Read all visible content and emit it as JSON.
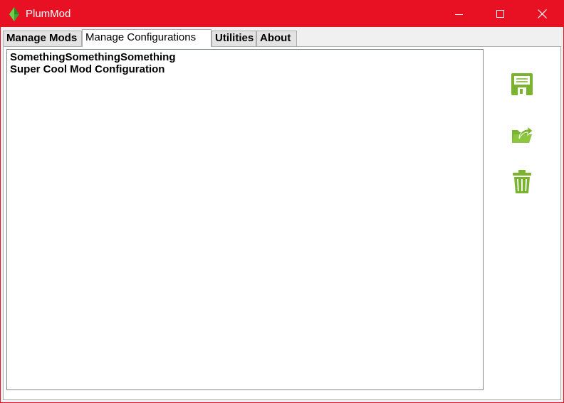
{
  "window": {
    "title": "PlumMod",
    "accent_color": "#e81123",
    "icon": "plumbob-icon",
    "controls": [
      "minimize-icon",
      "maximize-icon",
      "close-icon"
    ]
  },
  "tabs": [
    {
      "label": "Manage Mods",
      "active": false
    },
    {
      "label": "Manage Configurations",
      "active": true
    },
    {
      "label": "Utilities",
      "active": false
    },
    {
      "label": "About",
      "active": false
    }
  ],
  "configurations": [
    "SomethingSomethingSomething",
    "Super Cool Mod Configuration"
  ],
  "actions": {
    "icons": [
      "save-icon",
      "load-config-icon",
      "delete-icon"
    ],
    "icon_color": "#7ab32e"
  }
}
